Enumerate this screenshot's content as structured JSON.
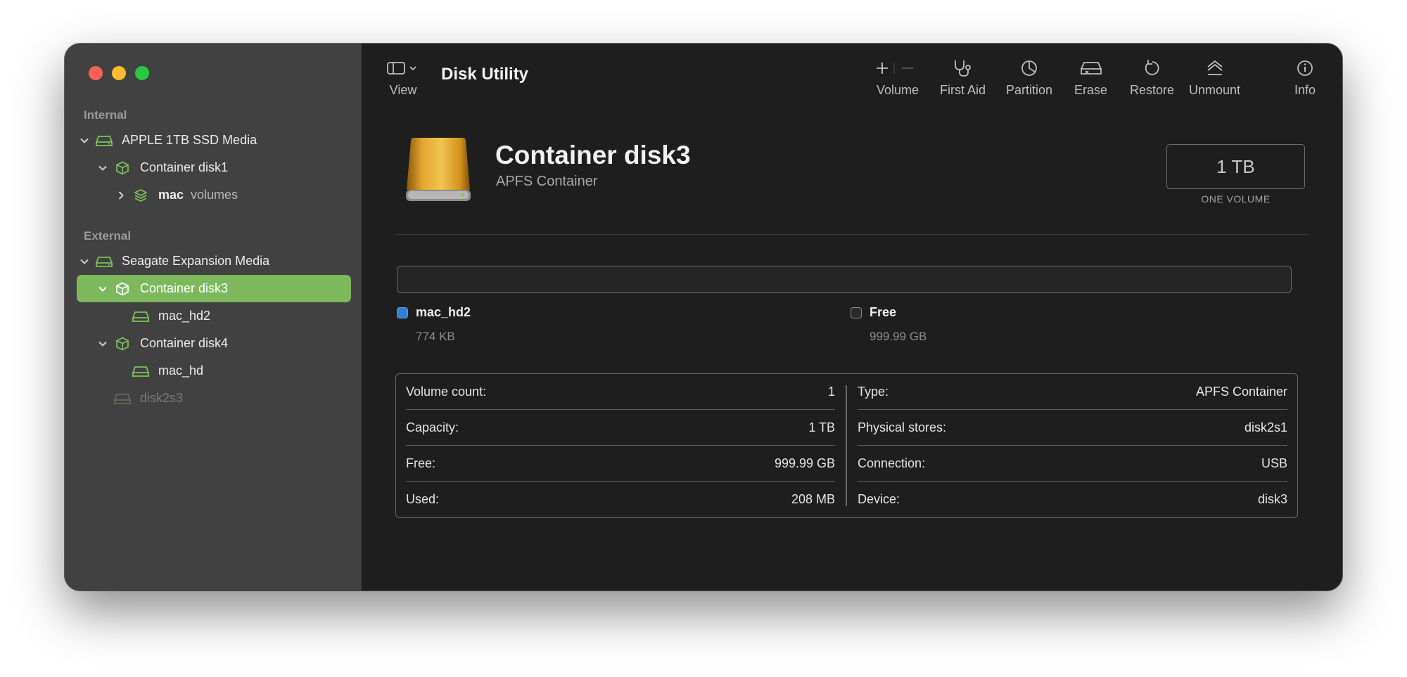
{
  "app": {
    "title": "Disk Utility"
  },
  "toolbar": {
    "view_label": "View",
    "volume_label": "Volume",
    "first_aid_label": "First Aid",
    "partition_label": "Partition",
    "erase_label": "Erase",
    "restore_label": "Restore",
    "unmount_label": "Unmount",
    "info_label": "Info"
  },
  "sidebar": {
    "internal_label": "Internal",
    "external_label": "External",
    "items": [
      {
        "label": "APPLE 1TB SSD Media"
      },
      {
        "label": "Container disk1"
      },
      {
        "label": "mac",
        "suffix": "volumes"
      },
      {
        "label": "Seagate Expansion Media"
      },
      {
        "label": "Container disk3"
      },
      {
        "label": "mac_hd2"
      },
      {
        "label": "Container disk4"
      },
      {
        "label": "mac_hd"
      },
      {
        "label": "disk2s3"
      }
    ]
  },
  "header": {
    "name": "Container disk3",
    "subtitle": "APFS Container",
    "size": "1 TB",
    "size_caption": "ONE VOLUME"
  },
  "usage": {
    "legend": [
      {
        "name": "mac_hd2",
        "value": "774 KB",
        "color": "#2f7fd6"
      },
      {
        "name": "Free",
        "value": "999.99 GB",
        "color": "#2a2a2a"
      }
    ]
  },
  "info": {
    "left": [
      {
        "key": "Volume count:",
        "value": "1"
      },
      {
        "key": "Capacity:",
        "value": "1 TB"
      },
      {
        "key": "Free:",
        "value": "999.99 GB"
      },
      {
        "key": "Used:",
        "value": "208 MB"
      }
    ],
    "right": [
      {
        "key": "Type:",
        "value": "APFS Container"
      },
      {
        "key": "Physical stores:",
        "value": "disk2s1"
      },
      {
        "key": "Connection:",
        "value": "USB"
      },
      {
        "key": "Device:",
        "value": "disk3"
      }
    ]
  },
  "colors": {
    "accent": "#7db95c",
    "icon_green": "#7cc35b"
  }
}
